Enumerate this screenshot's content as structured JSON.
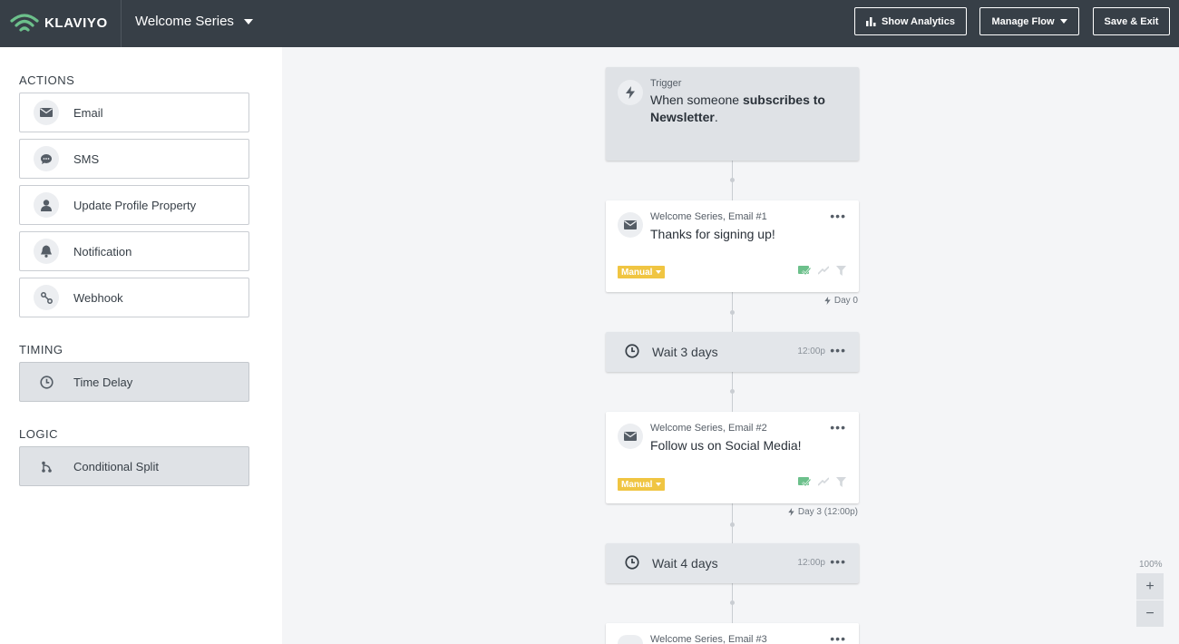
{
  "app": {
    "logo_text": "KLAVIYO",
    "flow_name": "Welcome Series"
  },
  "toolbar": {
    "show_analytics": "Show Analytics",
    "manage_flow": "Manage Flow",
    "save_exit": "Save & Exit"
  },
  "sidebar": {
    "actions_title": "ACTIONS",
    "actions": [
      {
        "label": "Email",
        "icon": "envelope-icon"
      },
      {
        "label": "SMS",
        "icon": "chat-bubble-icon"
      },
      {
        "label": "Update Profile Property",
        "icon": "user-icon"
      },
      {
        "label": "Notification",
        "icon": "bell-icon"
      },
      {
        "label": "Webhook",
        "icon": "webhook-icon"
      }
    ],
    "timing_title": "TIMING",
    "timing": [
      {
        "label": "Time Delay",
        "icon": "clock-icon"
      }
    ],
    "logic_title": "LOGIC",
    "logic": [
      {
        "label": "Conditional Split",
        "icon": "split-icon"
      }
    ]
  },
  "flow": {
    "trigger": {
      "label": "Trigger",
      "prefix": "When someone ",
      "bold": "subscribes to Newsletter",
      "suffix": "."
    },
    "email1": {
      "sub": "Welcome Series, Email #1",
      "title": "Thanks for signing up!",
      "badge": "Manual",
      "day": "Day 0"
    },
    "wait1": {
      "label": "Wait 3 days",
      "time": "12:00p"
    },
    "email2": {
      "sub": "Welcome Series, Email #2",
      "title": "Follow us on Social Media!",
      "badge": "Manual",
      "day": "Day 3 (12:00p)"
    },
    "wait2": {
      "label": "Wait 4 days",
      "time": "12:00p"
    },
    "email3": {
      "sub": "Welcome Series, Email #3"
    },
    "more_label": "•••"
  },
  "zoom": {
    "level": "100%",
    "plus": "+",
    "minus": "−"
  },
  "colors": {
    "topbar": "#373f47",
    "badge": "#f0c542",
    "success": "#6cc08b"
  }
}
